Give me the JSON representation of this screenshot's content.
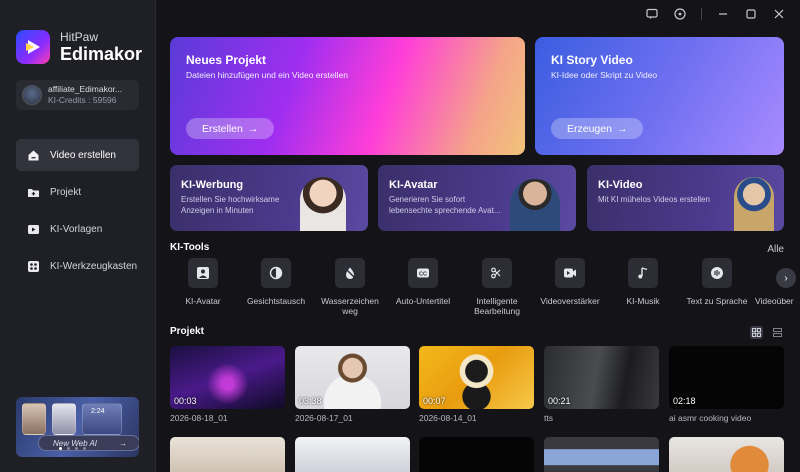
{
  "brand": {
    "line1": "HitPaw",
    "line2": "Edimakor"
  },
  "account": {
    "name": "affiliate_Edimakor...",
    "credits": "KI-Credits : 59596"
  },
  "nav": [
    {
      "label": "Video erstellen",
      "icon": "home-icon",
      "active": true
    },
    {
      "label": "Projekt",
      "icon": "folder-icon"
    },
    {
      "label": "KI-Vorlagen",
      "icon": "template-icon"
    },
    {
      "label": "KI-Werkzeugkasten",
      "icon": "toolbox-icon"
    }
  ],
  "promo": {
    "label": "New Web AI",
    "time": "2:24"
  },
  "hero": {
    "new_project": {
      "title": "Neues Projekt",
      "subtitle": "Dateien hinzufügen und ein Video erstellen",
      "button": "Erstellen"
    },
    "story": {
      "title": "KI Story Video",
      "subtitle": "KI-Idee oder Skript zu Video",
      "button": "Erzeugen"
    }
  },
  "features": [
    {
      "title": "KI-Werbung",
      "subtitle": "Erstellen Sie hochwirksame Anzeigen in Minuten"
    },
    {
      "title": "KI-Avatar",
      "subtitle": "Generieren Sie sofort lebensechte sprechende Avat..."
    },
    {
      "title": "KI-Video",
      "subtitle": "Mit KI mühelos Videos erstellen"
    }
  ],
  "tools_section": {
    "title": "KI-Tools",
    "all": "Alle"
  },
  "tools": [
    {
      "label": "KI-Avatar",
      "icon": "avatar-icon"
    },
    {
      "label": "Gesichtstausch",
      "icon": "face-swap-icon"
    },
    {
      "label": "Wasserzeichen weg",
      "icon": "watermark-remove-icon"
    },
    {
      "label": "Auto-Untertitel",
      "icon": "subtitle-icon"
    },
    {
      "label": "Intelligente Bearbeitung",
      "icon": "smart-edit-icon"
    },
    {
      "label": "Videoverstärker",
      "icon": "video-enhance-icon"
    },
    {
      "label": "KI-Musik",
      "icon": "music-icon"
    },
    {
      "label": "Text zu Sprache",
      "icon": "tts-icon"
    },
    {
      "label": "Videoüber",
      "icon": "video-translate-icon"
    }
  ],
  "projects_section": {
    "title": "Projekt"
  },
  "projects": [
    {
      "name": "2026-08-18_01",
      "duration": "00:03"
    },
    {
      "name": "2026-08-17_01",
      "duration": "03:38"
    },
    {
      "name": "2026-08-14_01",
      "duration": "00:07"
    },
    {
      "name": "tts",
      "duration": "00:21"
    },
    {
      "name": "ai asmr cooking video",
      "duration": "02:18"
    }
  ]
}
